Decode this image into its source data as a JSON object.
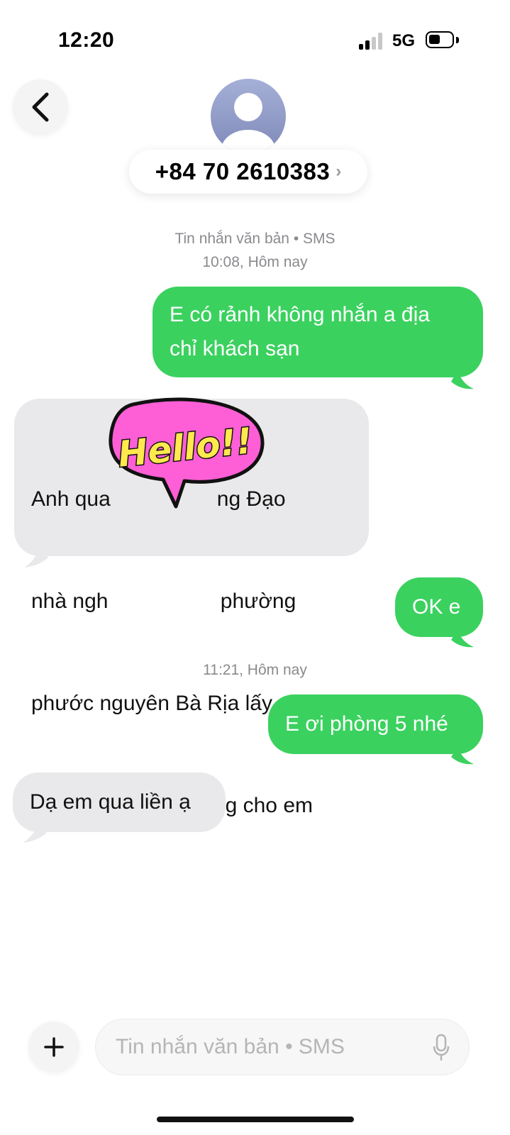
{
  "status_bar": {
    "time": "12:20",
    "network": "5G"
  },
  "header": {
    "contact": "+84 70 2610383",
    "chevron": "›"
  },
  "conversation": {
    "meta_top_line1": "Tin nhắn văn bản • SMS",
    "meta_top_line2": "10:08, Hôm nay",
    "meta_mid": "11:21, Hôm nay",
    "messages": [
      {
        "direction": "outgoing",
        "lines": [
          "E có rảnh không nhắn a địa",
          "chỉ khách sạn"
        ]
      },
      {
        "direction": "incoming",
        "lines": [
          "Anh qua                  ng Đạo",
          "nhà ngh                   phường",
          "phước nguyên Bà Rịa lấy",
          "phòng nhắn số phòng cho em"
        ]
      },
      {
        "direction": "outgoing",
        "lines": [
          "OK e"
        ]
      },
      {
        "direction": "outgoing",
        "lines": [
          "E ơi phòng 5 nhé"
        ]
      },
      {
        "direction": "incoming",
        "lines": [
          "Dạ em qua liền ạ"
        ]
      }
    ],
    "sticker_text": "Hello!!"
  },
  "composer": {
    "placeholder": "Tin nhắn văn bản • SMS"
  },
  "icons": {
    "back": "chevron-left-icon",
    "add": "plus-icon",
    "mic": "microphone-icon"
  },
  "colors": {
    "outgoing_bubble": "#3bd15f",
    "incoming_bubble": "#e9e9eb",
    "sticker_fill": "#ff5fd6"
  }
}
